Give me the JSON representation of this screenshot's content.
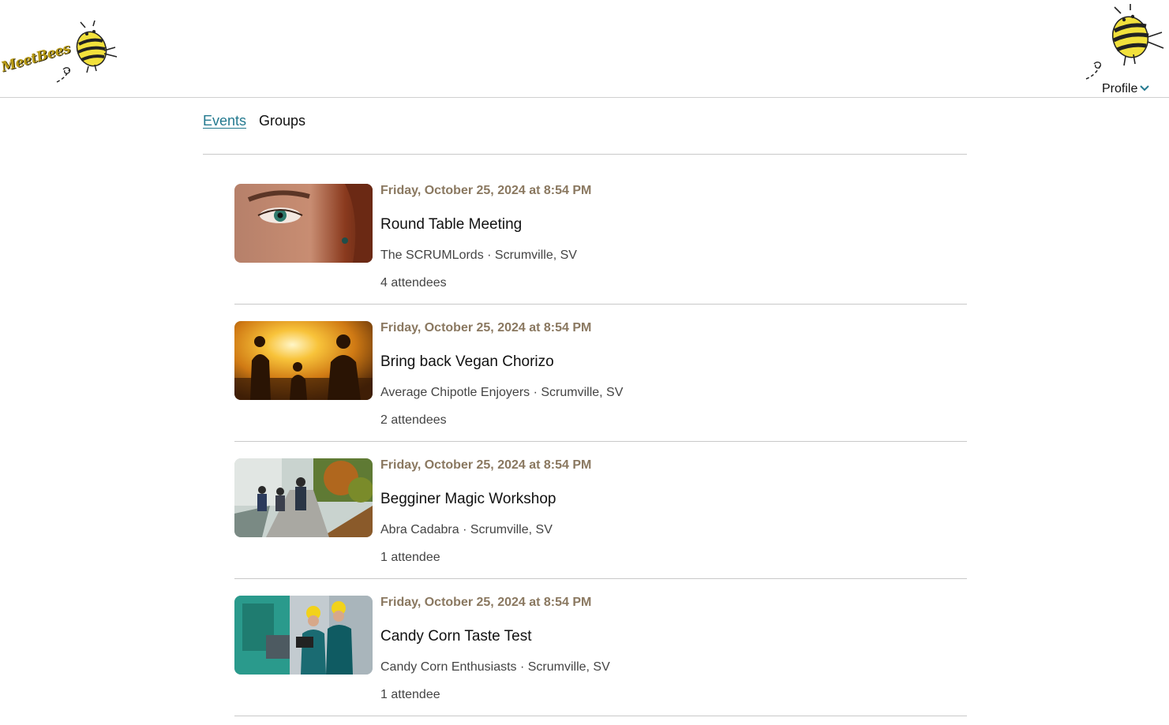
{
  "header": {
    "logo_text": "MeetBees",
    "profile_label": "Profile"
  },
  "tabs": [
    {
      "label": "Events",
      "active": true
    },
    {
      "label": "Groups",
      "active": false
    }
  ],
  "events": [
    {
      "date": "Friday, October 25, 2024 at 8:54 PM",
      "title": "Round Table Meeting",
      "meta": "The SCRUMLords · Scrumville, SV",
      "attendees": "4 attendees",
      "image": "woman-eye-closeup"
    },
    {
      "date": "Friday, October 25, 2024 at 8:54 PM",
      "title": "Bring back Vegan Chorizo",
      "meta": "Average Chipotle Enjoyers · Scrumville, SV",
      "attendees": "2 attendees",
      "image": "family-sunset-silhouette"
    },
    {
      "date": "Friday, October 25, 2024 at 8:54 PM",
      "title": "Begginer Magic Workshop",
      "meta": "Abra Cadabra · Scrumville, SV",
      "attendees": "1 attendee",
      "image": "people-walking-path"
    },
    {
      "date": "Friday, October 25, 2024 at 8:54 PM",
      "title": "Candy Corn Taste Test",
      "meta": "Candy Corn Enthusiasts · Scrumville, SV",
      "attendees": "1 attendee",
      "image": "engineers-hardhats"
    }
  ],
  "colors": {
    "accent": "#23798f",
    "date_text": "#8a7860",
    "divider": "#c9c9c9"
  }
}
